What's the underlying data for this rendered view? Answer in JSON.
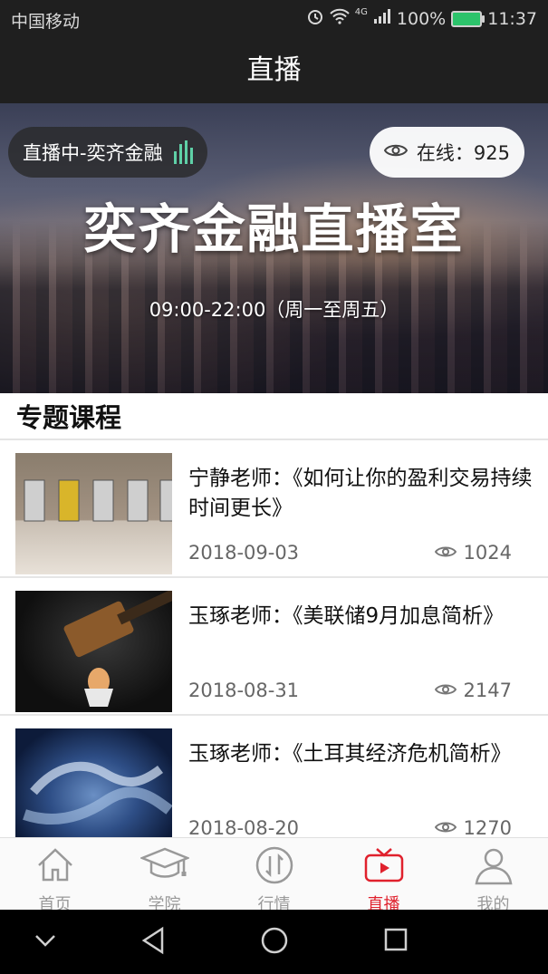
{
  "status_bar": {
    "carrier": "中国移动",
    "network": "4G",
    "battery": "100%",
    "time": "11:37"
  },
  "header": {
    "title": "直播"
  },
  "banner": {
    "live_label": "直播中-奕齐金融",
    "online_label": "在线：925",
    "title": "奕齐金融直播室",
    "schedule": "09:00-22:00（周一至周五）"
  },
  "section": {
    "title": "专题课程"
  },
  "courses": [
    {
      "title": "宁静老师：《如何让你的盈利交易持续时间更长》",
      "date": "2018-09-03",
      "views": "1024",
      "thumb_icon": "doors-photo"
    },
    {
      "title": "玉琢老师：《美联储9月加息简析》",
      "date": "2018-08-31",
      "views": "2147",
      "thumb_icon": "hammer-egg-photo"
    },
    {
      "title": "玉琢老师：《土耳其经济危机简析》",
      "date": "2018-08-20",
      "views": "1270",
      "thumb_icon": "globe-handshake-photo"
    }
  ],
  "tabs": [
    {
      "label": "首页",
      "icon": "home-icon"
    },
    {
      "label": "学院",
      "icon": "graduation-cap-icon"
    },
    {
      "label": "行情",
      "icon": "market-icon"
    },
    {
      "label": "直播",
      "icon": "tv-play-icon"
    },
    {
      "label": "我的",
      "icon": "user-icon"
    }
  ],
  "colors": {
    "accent": "#e0212d",
    "dark_bar": "#1f1f1f",
    "live_bars": "#5fd0a7"
  }
}
